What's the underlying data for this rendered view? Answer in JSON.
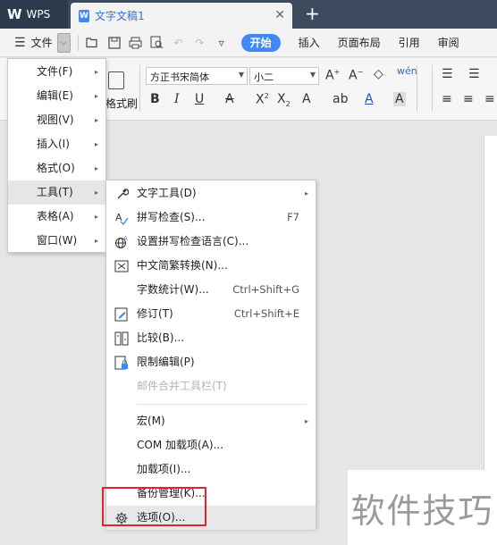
{
  "titlebar": {
    "app_name": "WPS",
    "document_tab": "文字文稿1",
    "doc_icon_letter": "W"
  },
  "toolbar": {
    "file_label": "文件",
    "start_tab": "开始",
    "tabs": [
      "插入",
      "页面布局",
      "引用",
      "审阅"
    ]
  },
  "ribbon": {
    "font_name": "方正书宋简体",
    "font_size": "小二",
    "format_brush_label": "格式刷"
  },
  "main_menu": {
    "items": [
      {
        "label": "文件(F)",
        "has_submenu": true
      },
      {
        "label": "编辑(E)",
        "has_submenu": true
      },
      {
        "label": "视图(V)",
        "has_submenu": true
      },
      {
        "label": "插入(I)",
        "has_submenu": true
      },
      {
        "label": "格式(O)",
        "has_submenu": true
      },
      {
        "label": "工具(T)",
        "has_submenu": true,
        "active": true
      },
      {
        "label": "表格(A)",
        "has_submenu": true
      },
      {
        "label": "窗口(W)",
        "has_submenu": true
      }
    ]
  },
  "tools_menu": {
    "items": [
      {
        "label": "文字工具(D)",
        "icon": "wrench-icon",
        "has_submenu": true
      },
      {
        "label": "拼写检查(S)...",
        "icon": "spellcheck-icon",
        "shortcut": "F7"
      },
      {
        "label": "设置拼写检查语言(C)...",
        "icon": "globe-language-icon"
      },
      {
        "label": "中文简繁转换(N)...",
        "icon": "chinese-convert-icon"
      },
      {
        "label": "字数统计(W)...",
        "shortcut": "Ctrl+Shift+G"
      },
      {
        "label": "修订(T)",
        "icon": "revision-icon",
        "shortcut": "Ctrl+Shift+E"
      },
      {
        "label": "比较(B)...",
        "icon": "compare-icon"
      },
      {
        "label": "限制编辑(P)",
        "icon": "lock-doc-icon"
      },
      {
        "label": "邮件合并工具栏(T)",
        "disabled": true
      },
      {
        "label": "宏(M)",
        "has_submenu": true
      },
      {
        "label": "COM 加载项(A)..."
      },
      {
        "label": "加载项(I)..."
      },
      {
        "label": "备份管理(K)..."
      },
      {
        "label": "选项(O)...",
        "icon": "gear-icon",
        "hover": true
      }
    ]
  },
  "watermark": {
    "text": "软件技巧"
  },
  "colors": {
    "accent": "#3f88f5",
    "titlebar": "#3c4a5e",
    "highlight_border": "#e0242a"
  }
}
